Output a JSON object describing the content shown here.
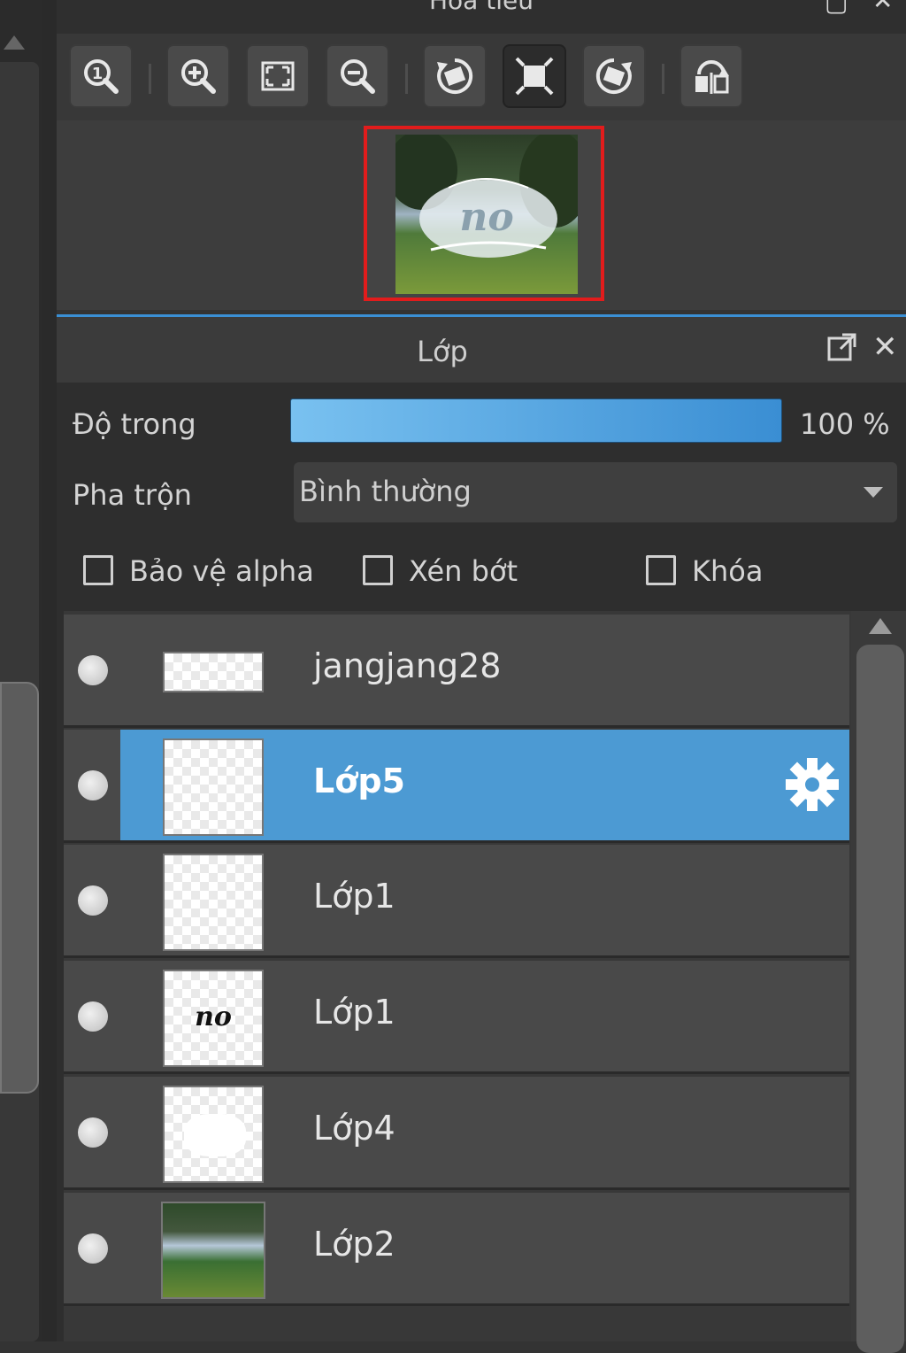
{
  "navigator": {
    "title": "Hoa tiêu",
    "tools": [
      {
        "icon": "zoom-actual-size-icon"
      },
      {
        "icon": "zoom-in-icon"
      },
      {
        "icon": "fit-to-window-icon"
      },
      {
        "icon": "zoom-out-icon"
      },
      {
        "icon": "rotate-left-icon"
      },
      {
        "icon": "reset-view-icon"
      },
      {
        "icon": "rotate-right-icon"
      },
      {
        "icon": "flip-horizontal-icon"
      }
    ]
  },
  "layers_panel": {
    "title": "Lớp",
    "opacity_label": "Độ trong",
    "opacity_value": "100 %",
    "opacity_fraction": 1.0,
    "blend_label": "Pha trộn",
    "blend_value": "Bình thường",
    "checkboxes": {
      "protect_alpha": "Bảo vệ alpha",
      "clipping": "Xén bớt",
      "lock": "Khóa"
    },
    "layers": [
      {
        "name": "jangjang28",
        "selected": false,
        "thumb": "transparent-strip"
      },
      {
        "name": "Lớp5",
        "selected": true,
        "thumb": "transparent"
      },
      {
        "name": "Lớp1",
        "selected": false,
        "thumb": "transparent"
      },
      {
        "name": "Lớp1",
        "selected": false,
        "thumb": "script-text",
        "thumb_text": "no"
      },
      {
        "name": "Lớp4",
        "selected": false,
        "thumb": "white-shape"
      },
      {
        "name": "Lớp2",
        "selected": false,
        "thumb": "photo"
      }
    ]
  },
  "colors": {
    "accent": "#4c9ad3",
    "preview_border": "#e21c1c"
  }
}
